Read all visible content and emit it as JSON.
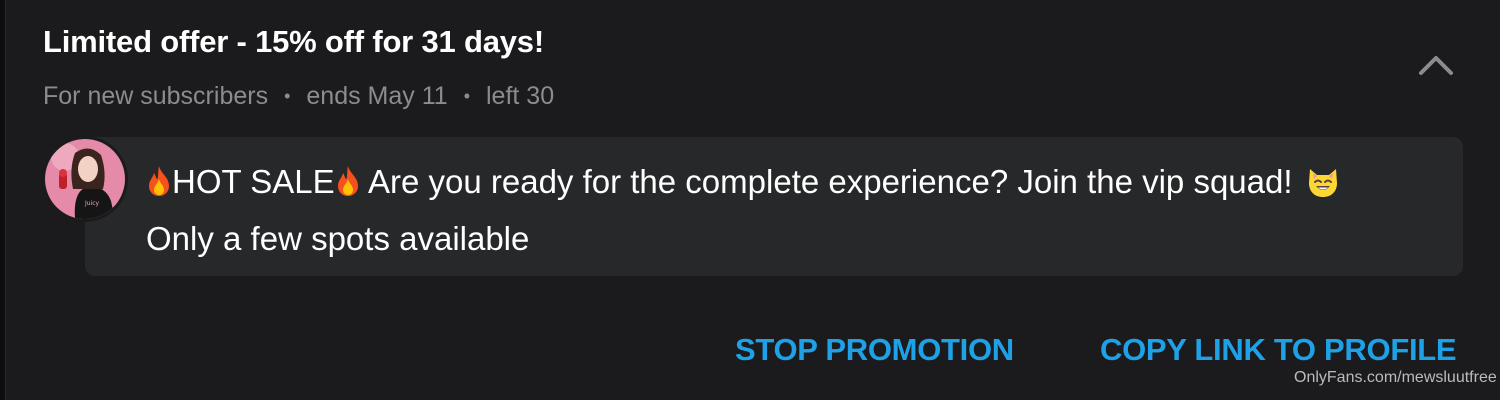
{
  "offer": {
    "title": "Limited offer - 15% off for 31 days!",
    "audience": "For new subscribers",
    "ends": "ends May 11",
    "left": "left 30"
  },
  "message": {
    "hot_sale": "HOT SALE",
    "text_part1": " Are you ready for the complete experience? Join the vip squad! ",
    "text_part2": " Only a few spots available",
    "icons": [
      "fire-emoji",
      "fire-emoji",
      "smiling-cat-emoji"
    ]
  },
  "actions": {
    "stop_promotion": "STOP PROMOTION",
    "copy_link": "COPY LINK TO PROFILE"
  },
  "watermark": "OnlyFans.com/mewsluutfree",
  "colors": {
    "background": "#1b1b1d",
    "bubble": "#26282a",
    "accent": "#1ea1e6",
    "muted_text": "#8a8c8e"
  }
}
